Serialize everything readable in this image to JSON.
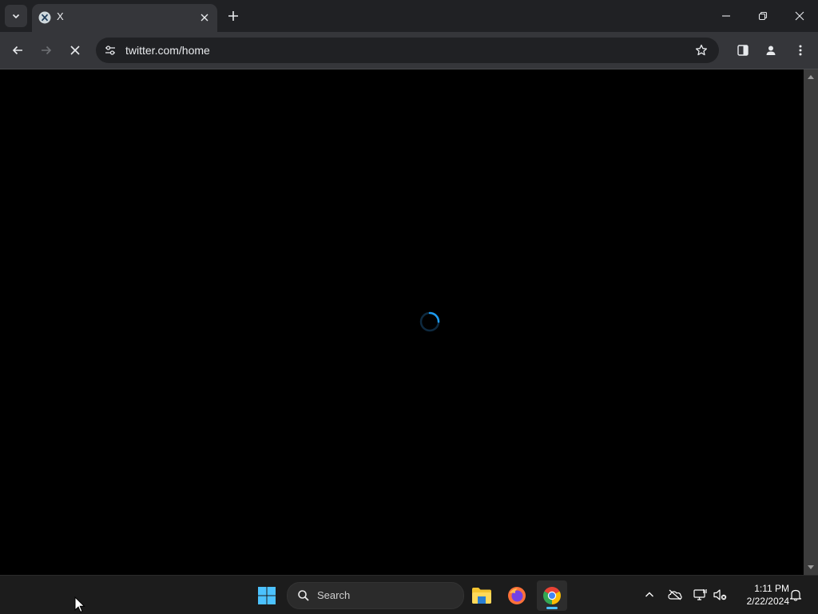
{
  "browser": {
    "tab": {
      "title": "X",
      "favicon": "x-logo-icon"
    },
    "address_bar": {
      "url": "twitter.com/home"
    },
    "icons": {
      "tab_search": "chevron-down-icon",
      "tab_close": "close-icon",
      "new_tab": "plus-icon",
      "minimize": "minimize-icon",
      "restore": "restore-icon",
      "close_window": "close-icon",
      "back": "arrow-left-icon",
      "forward": "arrow-right-icon",
      "stop": "stop-loading-icon",
      "site_info": "tune-icon",
      "bookmark": "star-icon",
      "side_panel": "side-panel-icon",
      "profile": "profile-icon",
      "menu": "kebab-menu-icon"
    }
  },
  "page": {
    "state": "loading",
    "spinner_color": "#1d9bf0",
    "background": "#000000"
  },
  "taskbar": {
    "search": {
      "label": "Search"
    },
    "apps": [
      "start-icon",
      "file-explorer-icon",
      "firefox-icon",
      "chrome-icon"
    ],
    "active_app": "chrome-icon",
    "tray": [
      "chevron-up-icon",
      "onedrive-icon",
      "network-icon",
      "volume-muted-icon"
    ],
    "clock": {
      "time": "1:11 PM",
      "date": "2/22/2024"
    },
    "notification_icon": "bell-icon"
  },
  "colors": {
    "titlebar": "#202124",
    "toolbar": "#35363a",
    "accent": "#4cc2ff"
  }
}
